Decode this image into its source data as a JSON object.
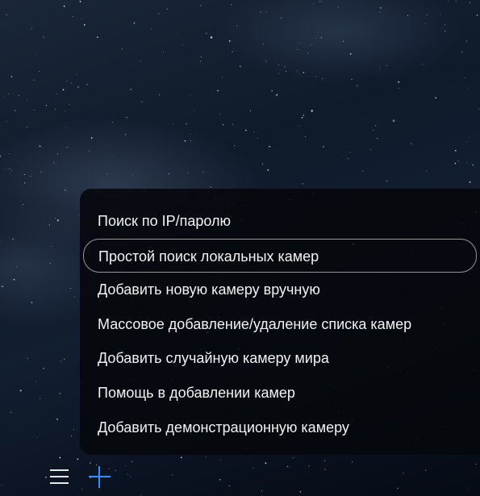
{
  "menu": {
    "items": [
      {
        "label": "Поиск по IP/паролю",
        "selected": false
      },
      {
        "label": "Простой поиск локальных камер",
        "selected": true
      },
      {
        "label": "Добавить новую камеру вручную",
        "selected": false
      },
      {
        "label": "Массовое добавление/удаление списка камер",
        "selected": false
      },
      {
        "label": "Добавить случайную камеру мира",
        "selected": false
      },
      {
        "label": "Помощь в добавлении камер",
        "selected": false
      },
      {
        "label": "Добавить демонстрационную камеру",
        "selected": false
      }
    ]
  },
  "toolbar": {
    "menu_icon": "hamburger-menu-icon",
    "add_icon": "plus-icon"
  },
  "colors": {
    "accent": "#2e8fff",
    "menu_background": "#06080c",
    "text": "#f2f2f2"
  }
}
